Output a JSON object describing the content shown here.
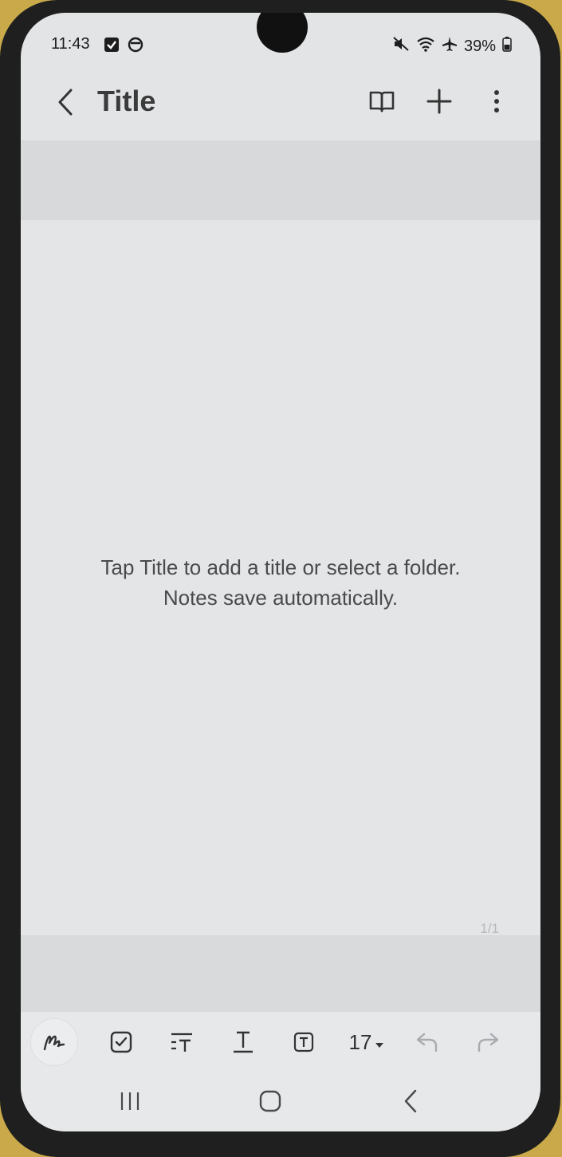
{
  "status_bar": {
    "time": "11:43",
    "battery": "39%",
    "left_icons": [
      "checkbox-notification-icon",
      "sync-notification-icon"
    ],
    "right_icons": [
      "mute-icon",
      "wifi-icon",
      "airplane-mode-icon",
      "battery-icon"
    ]
  },
  "app_bar": {
    "title": "Title",
    "actions": [
      "reading-mode-icon",
      "add-icon",
      "more-options-icon"
    ]
  },
  "note": {
    "hint_line1": "Tap Title to add a title or select a folder.",
    "hint_line2": "Notes save automatically.",
    "page_indicator": "1/1"
  },
  "toolbar": {
    "tools": [
      "pen-mode-icon",
      "checklist-icon",
      "text-style-icon",
      "text-format-icon",
      "text-box-icon"
    ],
    "font_size": "17",
    "undo": "undo-icon",
    "redo": "redo-icon"
  },
  "navigation": [
    "recent-apps-icon",
    "home-icon",
    "back-icon"
  ],
  "colors": {
    "background": "#e2e4e6",
    "band": "#d7d9db",
    "icon": "#333333",
    "disabled_icon": "#a9acaf"
  }
}
